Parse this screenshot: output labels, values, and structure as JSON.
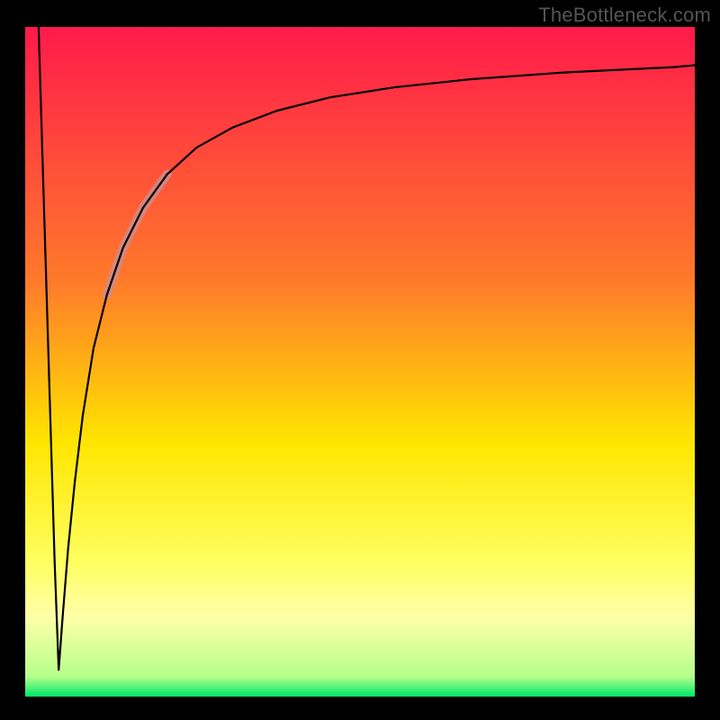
{
  "watermark": "TheBottleneck.com",
  "colors": {
    "gradient_top": "#ff1a4a",
    "gradient_mid_upper": "#ff7a2a",
    "gradient_mid": "#ffe500",
    "gradient_band_pale": "#ffffa8",
    "gradient_bottom": "#00e66a",
    "curve": "#000000",
    "highlight": "#cf8b8a",
    "frame_bg": "#000000"
  },
  "chart_data": {
    "type": "line",
    "title": "",
    "xlabel": "",
    "ylabel": "",
    "xlim": [
      0,
      100
    ],
    "ylim": [
      0,
      100
    ],
    "gradient_axis": "y",
    "gradient_stops": [
      {
        "offset": 0.0,
        "color": "#ff1a4a"
      },
      {
        "offset": 0.38,
        "color": "#ff7a2a"
      },
      {
        "offset": 0.62,
        "color": "#ffe500"
      },
      {
        "offset": 0.8,
        "color": "#ffff60"
      },
      {
        "offset": 0.88,
        "color": "#ffffa8"
      },
      {
        "offset": 0.97,
        "color": "#b6ff8a"
      },
      {
        "offset": 1.0,
        "color": "#00e66a"
      }
    ],
    "series": [
      {
        "name": "bottleneck-curve",
        "description": "Sharp initial drop to near-zero then asymptotic rise toward ~95",
        "x": [
          2.0,
          2.6,
          3.2,
          3.8,
          4.4,
          5.0,
          5.0,
          5.6,
          6.4,
          7.4,
          8.6,
          10.2,
          12.2,
          14.6,
          17.6,
          21.2,
          25.6,
          31.0,
          37.6,
          45.6,
          55.2,
          66.6,
          80.4,
          96.8,
          100.0
        ],
        "y": [
          100.0,
          80.0,
          60.0,
          40.0,
          20.0,
          4.0,
          4.0,
          12.0,
          22.0,
          32.0,
          42.0,
          52.0,
          60.0,
          67.0,
          73.0,
          78.0,
          82.0,
          85.0,
          87.5,
          89.5,
          91.0,
          92.2,
          93.2,
          94.0,
          94.3
        ]
      }
    ],
    "highlight_segment": {
      "description": "Pale pink emphasized segment on the rising limb",
      "x_range": [
        12.2,
        21.2
      ],
      "y_range": [
        60.0,
        78.0
      ]
    }
  }
}
